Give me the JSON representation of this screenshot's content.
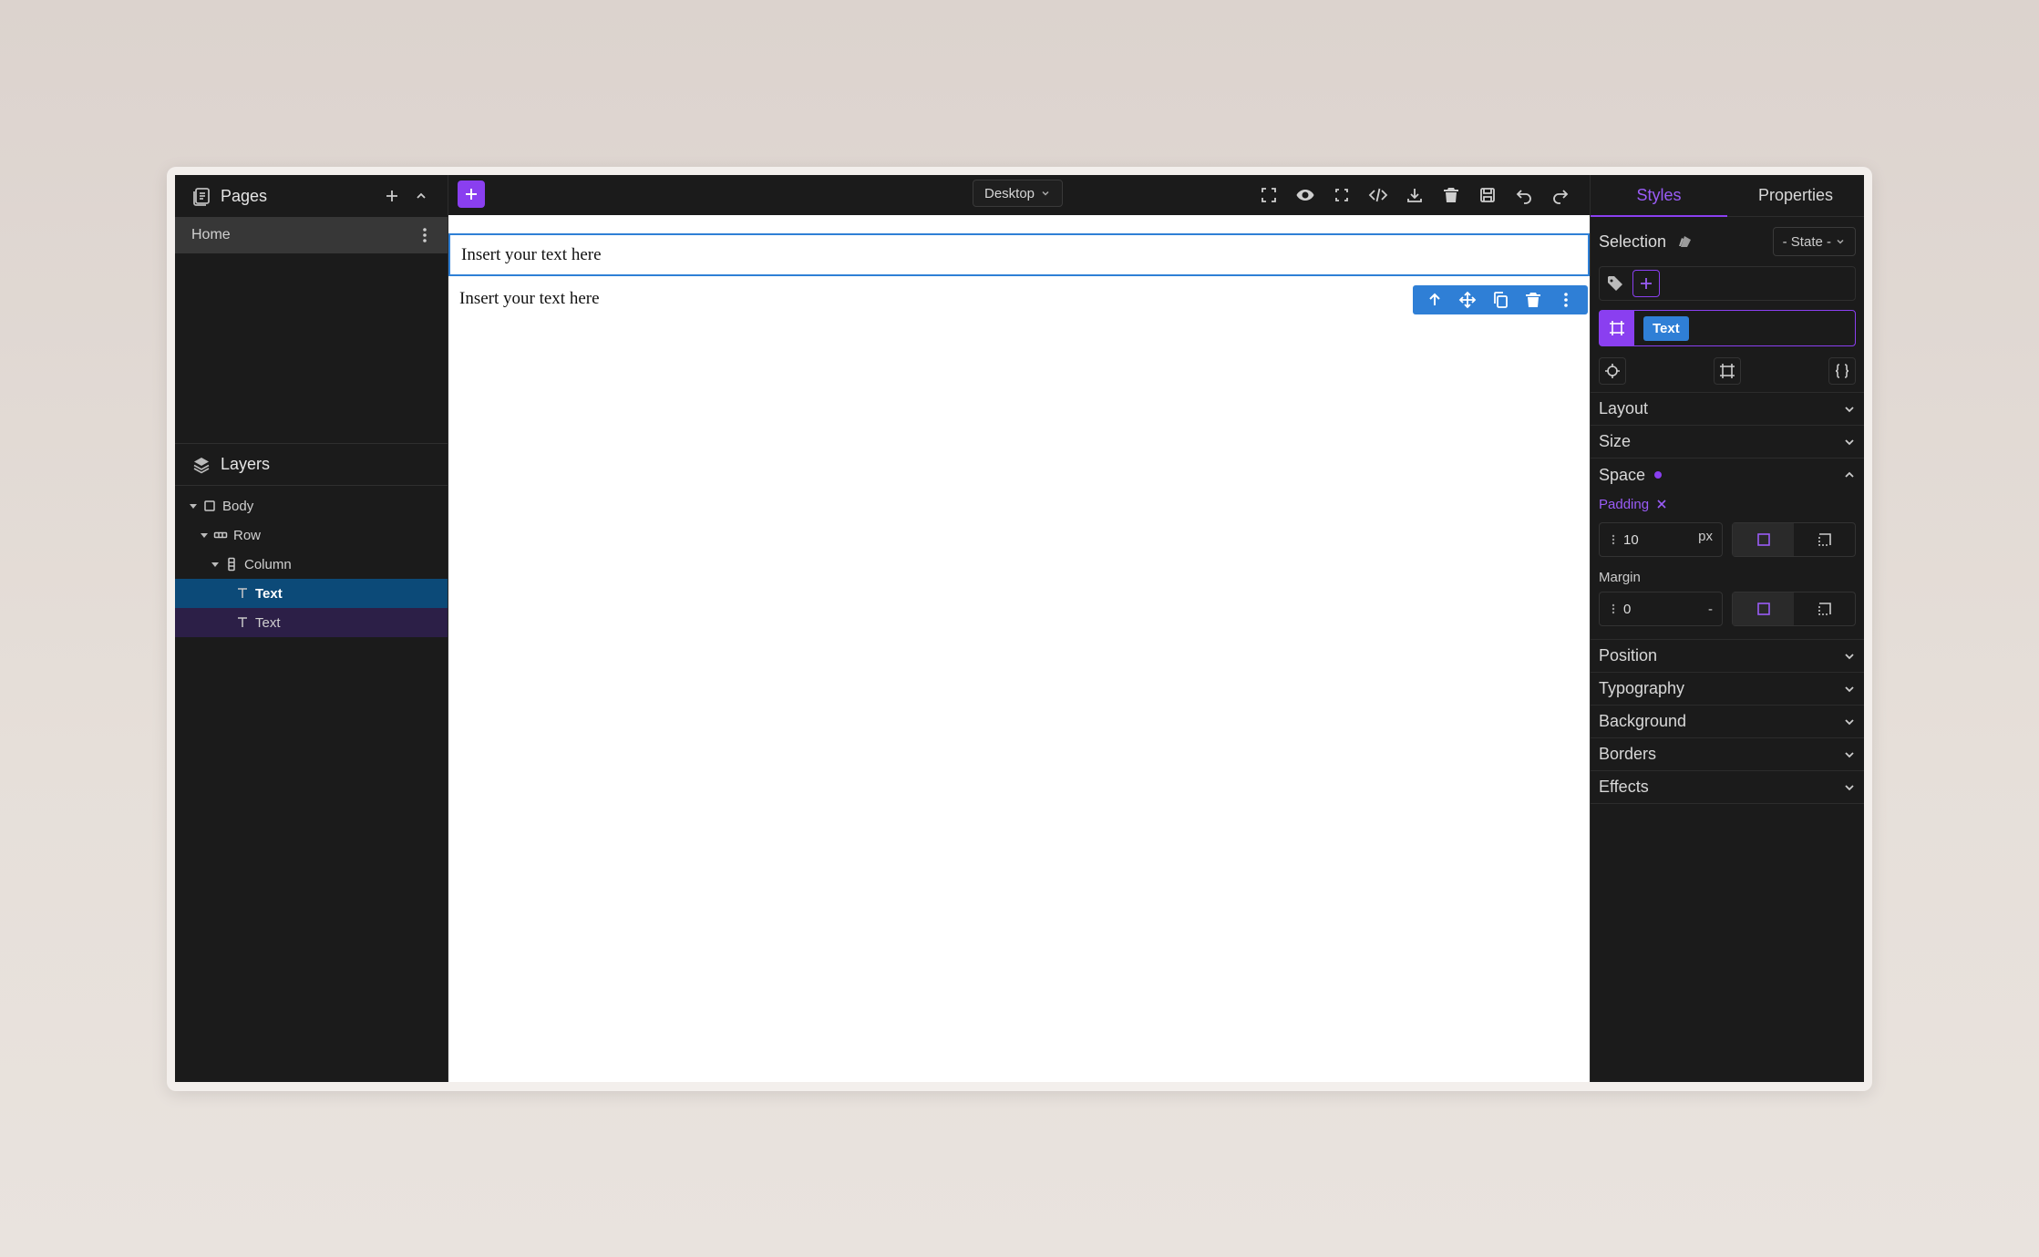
{
  "pages_panel": {
    "title": "Pages",
    "icon": "pages-icon",
    "items": [
      {
        "label": "Home"
      }
    ]
  },
  "layers_panel": {
    "title": "Layers",
    "icon": "layers-icon",
    "tree": [
      {
        "label": "Body",
        "icon": "square-icon",
        "depth": 0
      },
      {
        "label": "Row",
        "icon": "row-icon",
        "depth": 1
      },
      {
        "label": "Column",
        "icon": "column-icon",
        "depth": 2
      },
      {
        "label": "Text",
        "icon": "text-icon",
        "depth": 3,
        "state": "selected"
      },
      {
        "label": "Text",
        "icon": "text-icon",
        "depth": 3,
        "state": "hovered"
      }
    ]
  },
  "topbar": {
    "device": "Desktop",
    "tools": [
      "fullscreen-icon",
      "preview-eye-icon",
      "outline-icon",
      "code-icon",
      "download-icon",
      "trash-icon",
      "save-icon",
      "undo-icon",
      "redo-icon"
    ]
  },
  "canvas": {
    "blocks": [
      {
        "text": "Insert your text here"
      },
      {
        "text": "Insert your text here"
      }
    ],
    "toolbar": [
      "arrow-up-icon",
      "move-icon",
      "copy-icon",
      "trash-icon",
      "more-icon"
    ]
  },
  "right_panel": {
    "tabs": [
      {
        "label": "Styles",
        "active": true
      },
      {
        "label": "Properties",
        "active": false
      }
    ],
    "selection_label": "Selection",
    "state_label": "- State -",
    "selected_class": "Text",
    "sections": {
      "layout": "Layout",
      "size": "Size",
      "space": "Space",
      "position": "Position",
      "typography": "Typography",
      "background": "Background",
      "borders": "Borders",
      "effects": "Effects"
    },
    "padding": {
      "label": "Padding",
      "value": "10",
      "unit": "px"
    },
    "margin": {
      "label": "Margin",
      "value": "0",
      "unit": "-"
    }
  },
  "colors": {
    "accent": "#8a3ff0",
    "selection_blue": "#2f7fd6",
    "panel_bg": "#1b1b1b"
  }
}
